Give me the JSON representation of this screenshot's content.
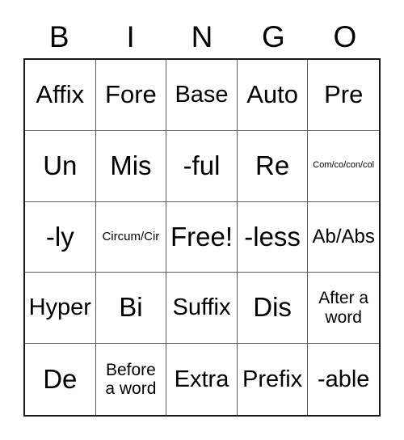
{
  "card": {
    "type": "bingo-card",
    "columns": 5,
    "rows": 5,
    "background_color": "#ffffff",
    "text_color": "#000000",
    "outer_border_color": "#1a1a1a",
    "inner_grid_color": "#5c5c5c"
  },
  "header": {
    "letters": [
      {
        "label": "B"
      },
      {
        "label": "I"
      },
      {
        "label": "N"
      },
      {
        "label": "G"
      },
      {
        "label": "O"
      }
    ]
  },
  "grid": {
    "cells": [
      {
        "text": "Affix",
        "size": "sz-lg",
        "row": 1,
        "col": 1
      },
      {
        "text": "Fore",
        "size": "sz-lg",
        "row": 1,
        "col": 2
      },
      {
        "text": "Base",
        "size": "sz-md",
        "row": 1,
        "col": 3
      },
      {
        "text": "Auto",
        "size": "sz-lg",
        "row": 1,
        "col": 4
      },
      {
        "text": "Pre",
        "size": "sz-lg",
        "row": 1,
        "col": 5
      },
      {
        "text": "Un",
        "size": "sz-xl",
        "row": 2,
        "col": 1
      },
      {
        "text": "Mis",
        "size": "sz-xl",
        "row": 2,
        "col": 2
      },
      {
        "text": "-ful",
        "size": "sz-xl",
        "row": 2,
        "col": 3
      },
      {
        "text": "Re",
        "size": "sz-xl",
        "row": 2,
        "col": 4
      },
      {
        "text": "Com/co/con/col",
        "size": "sz-tiny",
        "row": 2,
        "col": 5
      },
      {
        "text": "-ly",
        "size": "sz-xl",
        "row": 3,
        "col": 1
      },
      {
        "text": "Circum/Cir",
        "size": "sz-xxs",
        "row": 3,
        "col": 2
      },
      {
        "text": "Free!",
        "size": "sz-xl",
        "row": 3,
        "col": 3
      },
      {
        "text": "-less",
        "size": "sz-xl",
        "row": 3,
        "col": 4
      },
      {
        "text": "Ab/Abs",
        "size": "sz-sm",
        "row": 3,
        "col": 5
      },
      {
        "text": "Hyper",
        "size": "sz-md",
        "row": 4,
        "col": 1
      },
      {
        "text": "Bi",
        "size": "sz-xl",
        "row": 4,
        "col": 2
      },
      {
        "text": "Suffix",
        "size": "sz-md",
        "row": 4,
        "col": 3
      },
      {
        "text": "Dis",
        "size": "sz-xl",
        "row": 4,
        "col": 4
      },
      {
        "text": "After a\nword",
        "size": "sz-xs",
        "row": 4,
        "col": 5
      },
      {
        "text": "De",
        "size": "sz-xl",
        "row": 5,
        "col": 1
      },
      {
        "text": "Before\na word",
        "size": "sz-xs",
        "row": 5,
        "col": 2
      },
      {
        "text": "Extra",
        "size": "sz-md",
        "row": 5,
        "col": 3
      },
      {
        "text": "Prefix",
        "size": "sz-md",
        "row": 5,
        "col": 4
      },
      {
        "text": "-able",
        "size": "sz-md",
        "row": 5,
        "col": 5
      }
    ],
    "free_space_index": 12
  }
}
